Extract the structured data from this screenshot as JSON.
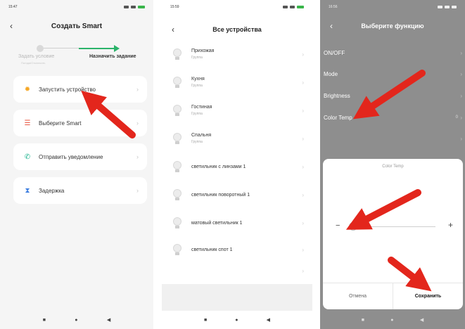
{
  "phone1": {
    "time": "15:47",
    "title": "Создать Smart",
    "step_left": "Задать условие",
    "step_left_sub": "Погода/Отключить",
    "step_right": "Назначить задание",
    "cards": [
      {
        "label": "Запустить устройство",
        "icon": "sun-icon"
      },
      {
        "label": "Выберите Smart",
        "icon": "smart-scene-icon"
      },
      {
        "label": "Отправить уведомление",
        "icon": "notification-icon"
      },
      {
        "label": "Задержка",
        "icon": "hourglass-icon"
      }
    ],
    "nav": [
      "■",
      "●",
      "◀"
    ]
  },
  "phone2": {
    "time": "15:59",
    "title": "Все устройства",
    "devices": [
      {
        "name": "Прихожая",
        "sub": "Группа"
      },
      {
        "name": "Кухня",
        "sub": "Группа"
      },
      {
        "name": "Гостиная",
        "sub": "Группа"
      },
      {
        "name": "Спальня",
        "sub": "Группа"
      },
      {
        "name": "светильник с линзами 1",
        "sub": ""
      },
      {
        "name": "светильник поворотный 1",
        "sub": ""
      },
      {
        "name": "матовый светильник 1",
        "sub": ""
      },
      {
        "name": "светильник спот 1",
        "sub": ""
      }
    ],
    "nav": [
      "■",
      "●",
      "◀"
    ]
  },
  "phone3": {
    "time": "16:56",
    "title": "Выберите функцию",
    "functions": [
      {
        "label": "ON/OFF",
        "value": ""
      },
      {
        "label": "Mode",
        "value": ""
      },
      {
        "label": "Brightness",
        "value": ""
      },
      {
        "label": "Color Temp",
        "value": "0"
      }
    ],
    "dialog": {
      "title": "Color Temp",
      "minus": "−",
      "plus": "+",
      "slider_level": 0,
      "cancel": "Отмена",
      "save": "Сохранить"
    },
    "nav": [
      "■",
      "●",
      "◀"
    ]
  },
  "colors": {
    "accent_green": "#2bb36a",
    "annotation_red": "#e3261c"
  }
}
